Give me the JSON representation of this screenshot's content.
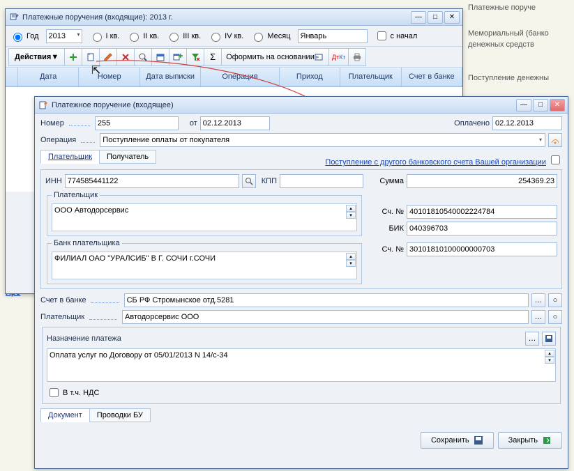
{
  "bg": {
    "line1": "Платежные поруче",
    "line2": "Мемориальный (банко",
    "line3": "денежных средств",
    "line4": "Поступление денежны",
    "bottom": "Про"
  },
  "main_window": {
    "title": "Платежные поручения (входящие): 2013 г.",
    "filter": {
      "year_label": "Год",
      "year": "2013",
      "q1": "I кв.",
      "q2": "II кв.",
      "q3": "III кв.",
      "q4": "IV кв.",
      "month_label": "Месяц",
      "month": "Январь",
      "from_start": "с начал"
    },
    "toolbar": {
      "actions": "Действия",
      "new_doc": "Оформить на основании"
    },
    "columns": [
      "",
      "Дата",
      "Номер",
      "Дата выписки",
      "Операция",
      "Приход",
      "Плательщик",
      "Счет в банке"
    ]
  },
  "dialog": {
    "title": "Платежное поручение (входящее)",
    "number_label": "Номер",
    "number": "255",
    "from_label": "от",
    "date": "02.12.2013",
    "paid_label": "Оплачено",
    "paid_date": "02.12.2013",
    "operation_label": "Операция",
    "operation": "Поступление оплаты от покупателя",
    "tabs": {
      "payer": "Плательщик",
      "recipient": "Получатель"
    },
    "other_account": "Поступление с другого банковского счета Вашей организации",
    "inn_label": "ИНН",
    "inn": "774585441122",
    "kpp_label": "КПП",
    "kpp": "",
    "payer_label": "Плательщик",
    "payer": "ООО Автодорсервис",
    "bank_label": "Банк плательщика",
    "bank": "ФИЛИАЛ ОАО \"УРАЛСИБ\" В Г. СОЧИ г.СОЧИ",
    "sum_label": "Сумма",
    "sum": "254369.23",
    "acc1_label": "Сч. №",
    "acc1": "40101810540002224784",
    "bik_label": "БИК",
    "bik": "040396703",
    "acc2_label": "Сч. №",
    "acc2": "30101810100000000703",
    "bank_account_label": "Счет в банке",
    "bank_account": "СБ РФ Стромынское отд.5281",
    "payer2_label": "Плательщик",
    "payer2": "Автодорсервис ООО",
    "purpose_label": "Назначение платежа",
    "purpose": "Оплата услуг по Договору от 05/01/2013 N 14/c-34",
    "vat": "В т.ч. НДС",
    "tabs2": {
      "doc": "Документ",
      "postings": "Проводки БУ"
    },
    "save": "Сохранить",
    "close": "Закрыть"
  }
}
